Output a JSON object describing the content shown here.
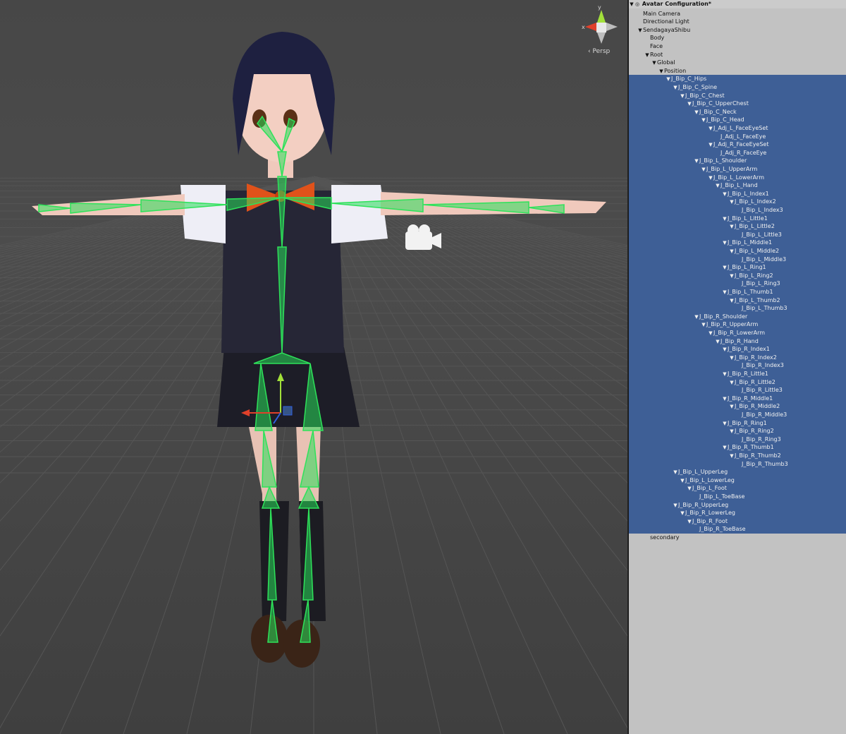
{
  "window": {
    "title": "Avatar Configuration*"
  },
  "scene": {
    "projection_label": "Persp",
    "gizmo_axes": {
      "x": "x",
      "y": "y"
    },
    "colors": {
      "background": "#4a4a4a",
      "grid": "#555555",
      "bone": "#2ee25a",
      "bone_fill": "rgba(40,220,90,0.55)",
      "selection": "#3e5f96"
    }
  },
  "hierarchy": {
    "rows": [
      {
        "label": "Main Camera",
        "depth": 0,
        "arrow": false,
        "selected": false
      },
      {
        "label": "Directional Light",
        "depth": 0,
        "arrow": false,
        "selected": false
      },
      {
        "label": "SendagayaShibu",
        "depth": 0,
        "arrow": true,
        "selected": false
      },
      {
        "label": "Body",
        "depth": 1,
        "arrow": false,
        "selected": false
      },
      {
        "label": "Face",
        "depth": 1,
        "arrow": false,
        "selected": false
      },
      {
        "label": "Root",
        "depth": 1,
        "arrow": true,
        "selected": false
      },
      {
        "label": "Global",
        "depth": 2,
        "arrow": true,
        "selected": false
      },
      {
        "label": "Position",
        "depth": 3,
        "arrow": true,
        "selected": false
      },
      {
        "label": "J_Bip_C_Hips",
        "depth": 4,
        "arrow": true,
        "selected": true
      },
      {
        "label": "J_Bip_C_Spine",
        "depth": 5,
        "arrow": true,
        "selected": true
      },
      {
        "label": "J_Bip_C_Chest",
        "depth": 6,
        "arrow": true,
        "selected": true
      },
      {
        "label": "J_Bip_C_UpperChest",
        "depth": 7,
        "arrow": true,
        "selected": true
      },
      {
        "label": "J_Bip_C_Neck",
        "depth": 8,
        "arrow": true,
        "selected": true
      },
      {
        "label": "J_Bip_C_Head",
        "depth": 9,
        "arrow": true,
        "selected": true
      },
      {
        "label": "J_Adj_L_FaceEyeSet",
        "depth": 10,
        "arrow": true,
        "selected": true
      },
      {
        "label": "J_Adj_L_FaceEye",
        "depth": 11,
        "arrow": false,
        "selected": true
      },
      {
        "label": "J_Adj_R_FaceEyeSet",
        "depth": 10,
        "arrow": true,
        "selected": true
      },
      {
        "label": "J_Adj_R_FaceEye",
        "depth": 11,
        "arrow": false,
        "selected": true
      },
      {
        "label": "J_Bip_L_Shoulder",
        "depth": 8,
        "arrow": true,
        "selected": true
      },
      {
        "label": "J_Bip_L_UpperArm",
        "depth": 9,
        "arrow": true,
        "selected": true
      },
      {
        "label": "J_Bip_L_LowerArm",
        "depth": 10,
        "arrow": true,
        "selected": true
      },
      {
        "label": "J_Bip_L_Hand",
        "depth": 11,
        "arrow": true,
        "selected": true
      },
      {
        "label": "J_Bip_L_Index1",
        "depth": 12,
        "arrow": true,
        "selected": true
      },
      {
        "label": "J_Bip_L_Index2",
        "depth": 13,
        "arrow": true,
        "selected": true
      },
      {
        "label": "J_Bip_L_Index3",
        "depth": 14,
        "arrow": false,
        "selected": true
      },
      {
        "label": "J_Bip_L_Little1",
        "depth": 12,
        "arrow": true,
        "selected": true
      },
      {
        "label": "J_Bip_L_Little2",
        "depth": 13,
        "arrow": true,
        "selected": true
      },
      {
        "label": "J_Bip_L_Little3",
        "depth": 14,
        "arrow": false,
        "selected": true
      },
      {
        "label": "J_Bip_L_Middle1",
        "depth": 12,
        "arrow": true,
        "selected": true
      },
      {
        "label": "J_Bip_L_Middle2",
        "depth": 13,
        "arrow": true,
        "selected": true
      },
      {
        "label": "J_Bip_L_Middle3",
        "depth": 14,
        "arrow": false,
        "selected": true
      },
      {
        "label": "J_Bip_L_Ring1",
        "depth": 12,
        "arrow": true,
        "selected": true
      },
      {
        "label": "J_Bip_L_Ring2",
        "depth": 13,
        "arrow": true,
        "selected": true
      },
      {
        "label": "J_Bip_L_Ring3",
        "depth": 14,
        "arrow": false,
        "selected": true
      },
      {
        "label": "J_Bip_L_Thumb1",
        "depth": 12,
        "arrow": true,
        "selected": true
      },
      {
        "label": "J_Bip_L_Thumb2",
        "depth": 13,
        "arrow": true,
        "selected": true
      },
      {
        "label": "J_Bip_L_Thumb3",
        "depth": 14,
        "arrow": false,
        "selected": true
      },
      {
        "label": "J_Bip_R_Shoulder",
        "depth": 8,
        "arrow": true,
        "selected": true
      },
      {
        "label": "J_Bip_R_UpperArm",
        "depth": 9,
        "arrow": true,
        "selected": true
      },
      {
        "label": "J_Bip_R_LowerArm",
        "depth": 10,
        "arrow": true,
        "selected": true
      },
      {
        "label": "J_Bip_R_Hand",
        "depth": 11,
        "arrow": true,
        "selected": true
      },
      {
        "label": "J_Bip_R_Index1",
        "depth": 12,
        "arrow": true,
        "selected": true
      },
      {
        "label": "J_Bip_R_Index2",
        "depth": 13,
        "arrow": true,
        "selected": true
      },
      {
        "label": "J_Bip_R_Index3",
        "depth": 14,
        "arrow": false,
        "selected": true
      },
      {
        "label": "J_Bip_R_Little1",
        "depth": 12,
        "arrow": true,
        "selected": true
      },
      {
        "label": "J_Bip_R_Little2",
        "depth": 13,
        "arrow": true,
        "selected": true
      },
      {
        "label": "J_Bip_R_Little3",
        "depth": 14,
        "arrow": false,
        "selected": true
      },
      {
        "label": "J_Bip_R_Middle1",
        "depth": 12,
        "arrow": true,
        "selected": true
      },
      {
        "label": "J_Bip_R_Middle2",
        "depth": 13,
        "arrow": true,
        "selected": true
      },
      {
        "label": "J_Bip_R_Middle3",
        "depth": 14,
        "arrow": false,
        "selected": true
      },
      {
        "label": "J_Bip_R_Ring1",
        "depth": 12,
        "arrow": true,
        "selected": true
      },
      {
        "label": "J_Bip_R_Ring2",
        "depth": 13,
        "arrow": true,
        "selected": true
      },
      {
        "label": "J_Bip_R_Ring3",
        "depth": 14,
        "arrow": false,
        "selected": true
      },
      {
        "label": "J_Bip_R_Thumb1",
        "depth": 12,
        "arrow": true,
        "selected": true
      },
      {
        "label": "J_Bip_R_Thumb2",
        "depth": 13,
        "arrow": true,
        "selected": true
      },
      {
        "label": "J_Bip_R_Thumb3",
        "depth": 14,
        "arrow": false,
        "selected": true
      },
      {
        "label": "J_Bip_L_UpperLeg",
        "depth": 5,
        "arrow": true,
        "selected": true
      },
      {
        "label": "J_Bip_L_LowerLeg",
        "depth": 6,
        "arrow": true,
        "selected": true
      },
      {
        "label": "J_Bip_L_Foot",
        "depth": 7,
        "arrow": true,
        "selected": true
      },
      {
        "label": "J_Bip_L_ToeBase",
        "depth": 8,
        "arrow": false,
        "selected": true
      },
      {
        "label": "J_Bip_R_UpperLeg",
        "depth": 5,
        "arrow": true,
        "selected": true
      },
      {
        "label": "J_Bip_R_LowerLeg",
        "depth": 6,
        "arrow": true,
        "selected": true
      },
      {
        "label": "J_Bip_R_Foot",
        "depth": 7,
        "arrow": true,
        "selected": true
      },
      {
        "label": "J_Bip_R_ToeBase",
        "depth": 8,
        "arrow": false,
        "selected": true
      },
      {
        "label": "secondary",
        "depth": 1,
        "arrow": false,
        "selected": false
      }
    ]
  }
}
